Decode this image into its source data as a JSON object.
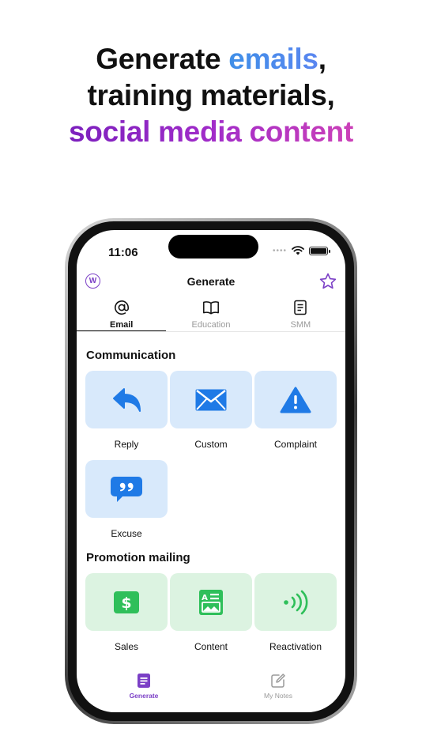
{
  "headline": {
    "line1_prefix": "Generate ",
    "line1_highlight": "emails",
    "line1_suffix": ",",
    "line2": "training materials,",
    "line3": "social media content"
  },
  "status_bar": {
    "time": "11:06",
    "icons": [
      "signal-dots-icon",
      "wifi-icon",
      "battery-icon"
    ]
  },
  "nav": {
    "logo_letter": "W",
    "title": "Generate",
    "favorite_icon": "star-icon"
  },
  "tabs": [
    {
      "label": "Email",
      "icon": "at-sign-icon",
      "active": true
    },
    {
      "label": "Education",
      "icon": "book-icon",
      "active": false
    },
    {
      "label": "SMM",
      "icon": "document-icon",
      "active": false
    }
  ],
  "sections": {
    "communication": {
      "title": "Communication",
      "items": [
        {
          "label": "Reply",
          "icon": "reply-arrow-icon"
        },
        {
          "label": "Custom",
          "icon": "envelope-icon"
        },
        {
          "label": "Complaint",
          "icon": "warning-triangle-icon"
        },
        {
          "label": "Excuse",
          "icon": "quote-bubble-icon"
        }
      ]
    },
    "promotion": {
      "title": "Promotion mailing",
      "items": [
        {
          "label": "Sales",
          "icon": "dollar-sign-icon"
        },
        {
          "label": "Content",
          "icon": "text-image-icon"
        },
        {
          "label": "Reactivation",
          "icon": "signal-waves-icon"
        }
      ]
    }
  },
  "bottom_nav": [
    {
      "label": "Generate",
      "icon": "generate-doc-icon",
      "active": true
    },
    {
      "label": "My Notes",
      "icon": "compose-note-icon",
      "active": false
    }
  ],
  "colors": {
    "accent_purple": "#7b3fc6",
    "tile_blue": "#d8e9fb",
    "icon_blue": "#1f7ae6",
    "tile_green": "#dcf3e1",
    "icon_green": "#2fbf5a"
  }
}
